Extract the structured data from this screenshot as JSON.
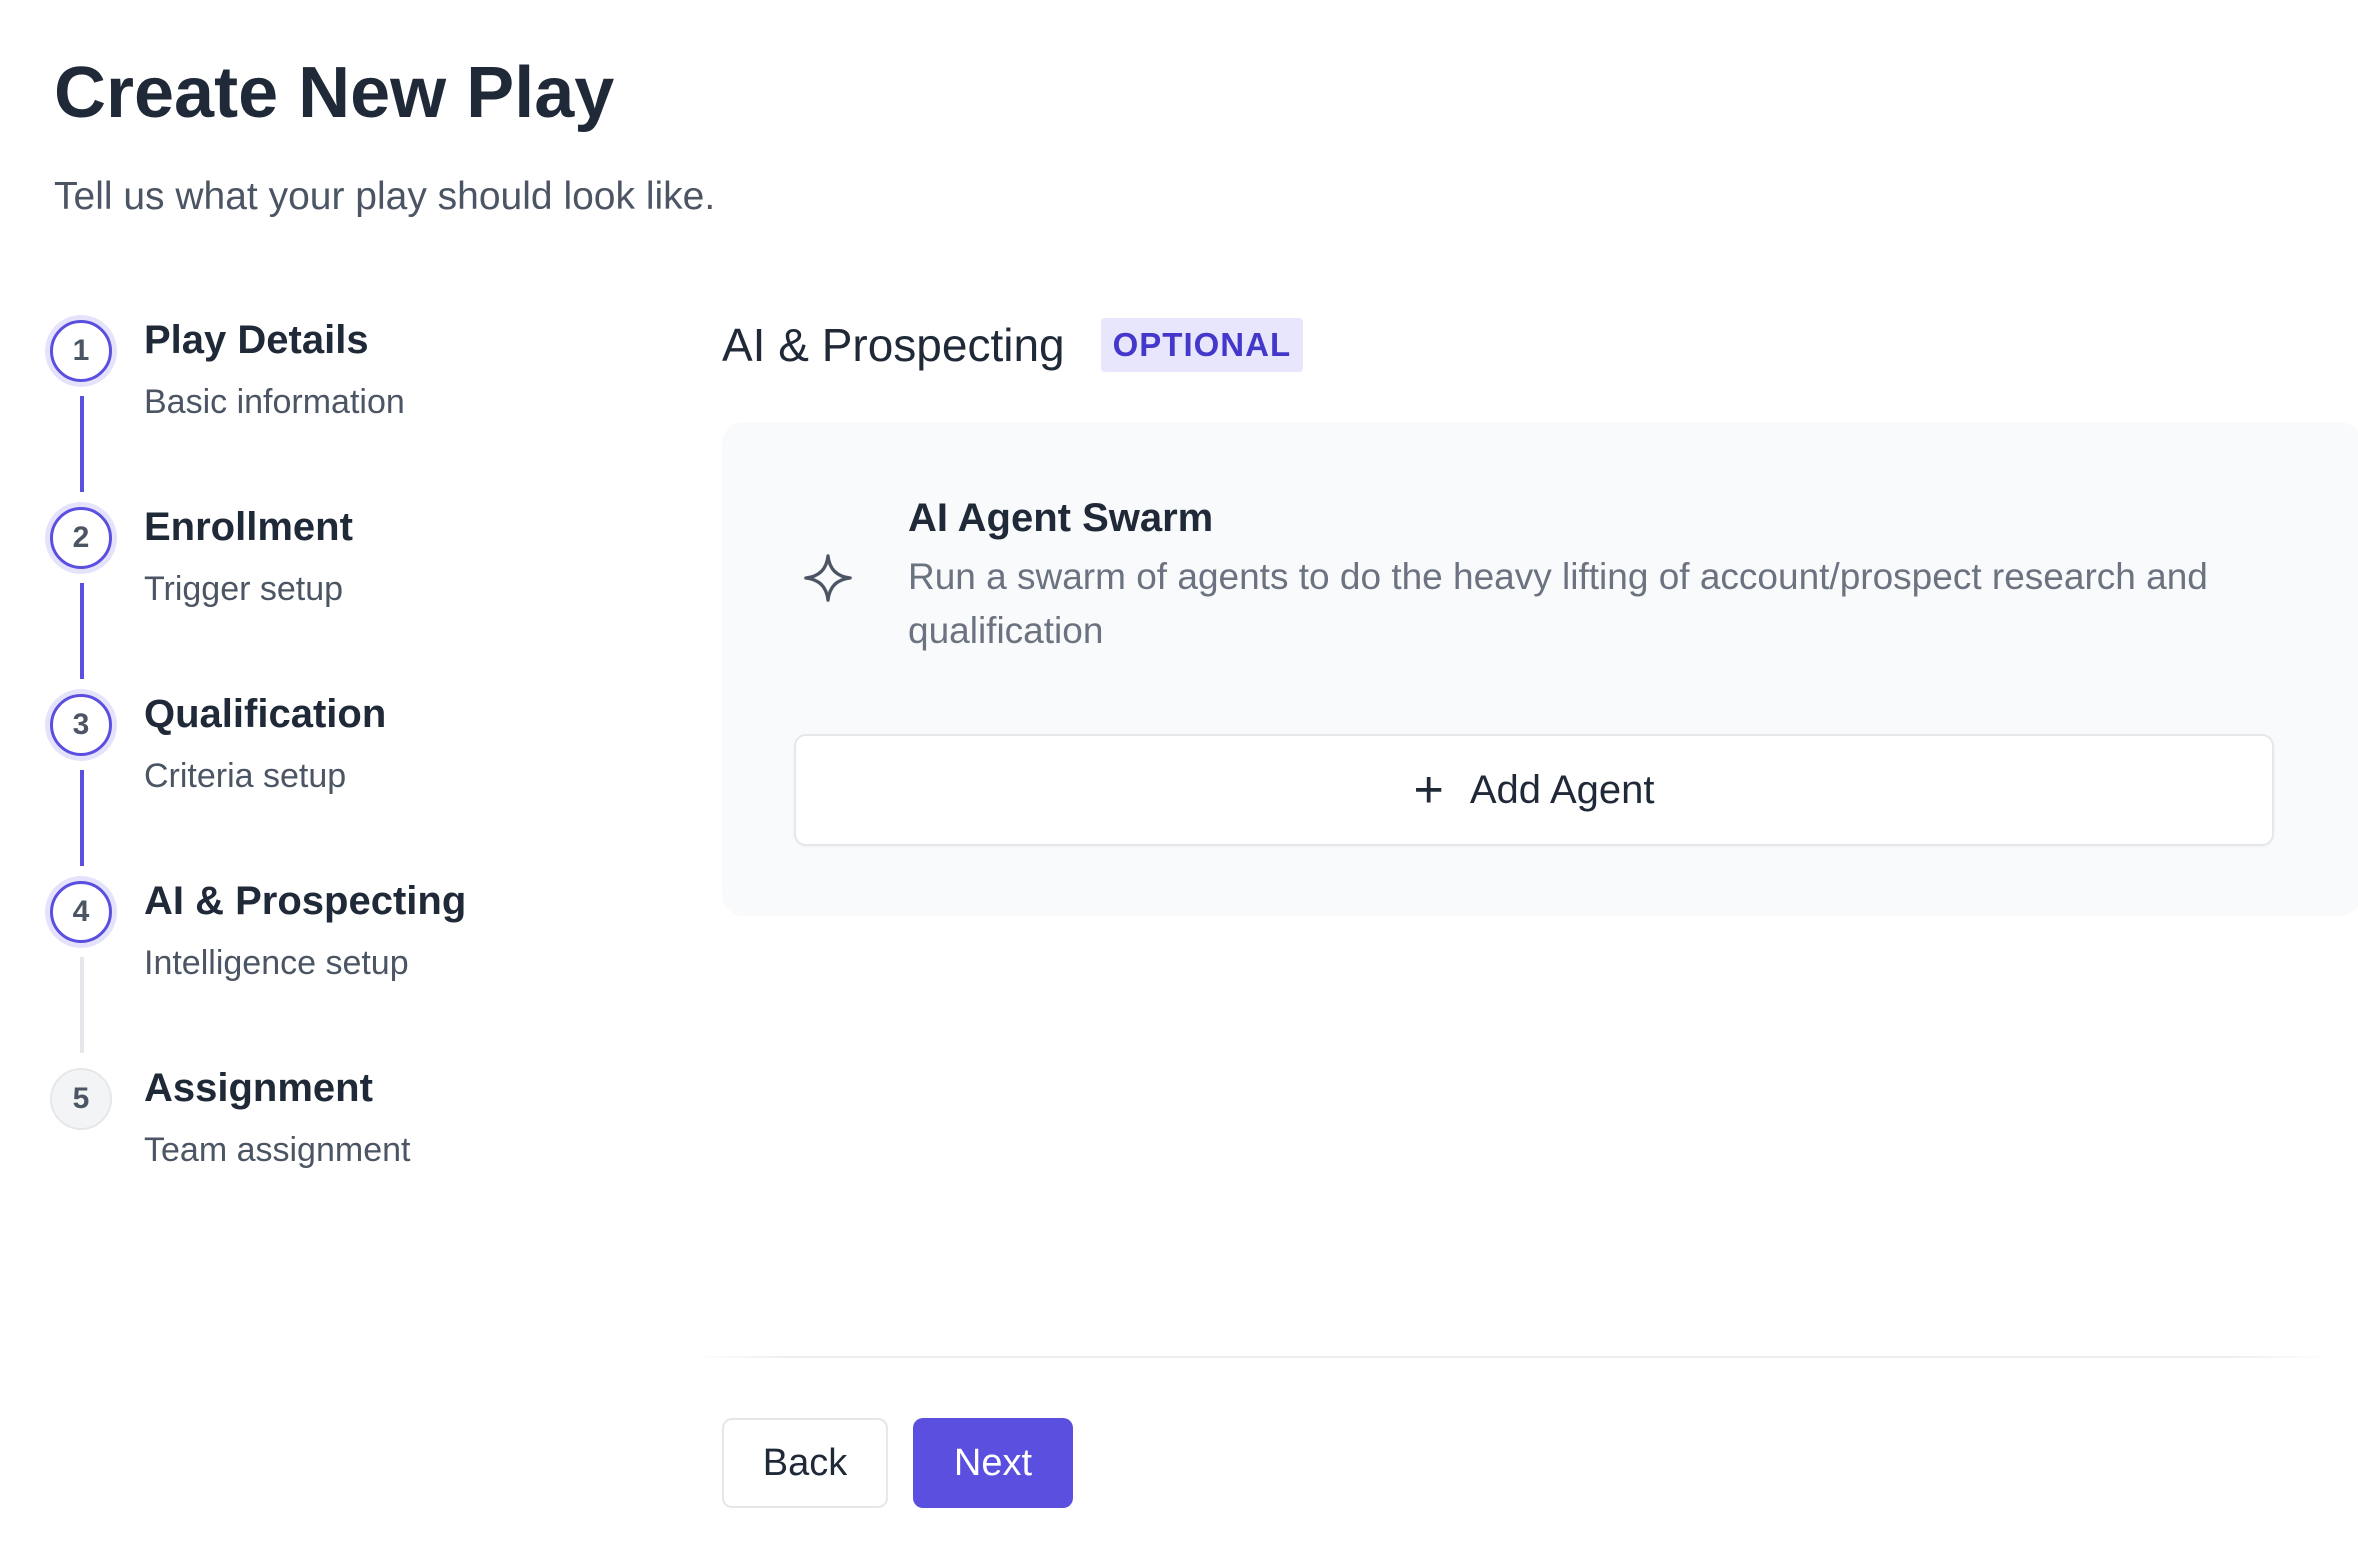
{
  "page": {
    "title": "Create New Play",
    "subtitle": "Tell us what your play should look like."
  },
  "stepper": {
    "steps": [
      {
        "number": "1",
        "title": "Play Details",
        "subtitle": "Basic information",
        "state": "completed"
      },
      {
        "number": "2",
        "title": "Enrollment",
        "subtitle": "Trigger setup",
        "state": "completed"
      },
      {
        "number": "3",
        "title": "Qualification",
        "subtitle": "Criteria setup",
        "state": "completed"
      },
      {
        "number": "4",
        "title": "AI & Prospecting",
        "subtitle": "Intelligence setup",
        "state": "active"
      },
      {
        "number": "5",
        "title": "Assignment",
        "subtitle": "Team assignment",
        "state": "upcoming"
      }
    ]
  },
  "section": {
    "title": "AI & Prospecting",
    "badge": "OPTIONAL"
  },
  "agent_card": {
    "icon": "sparkle-icon",
    "title": "AI Agent Swarm",
    "description": "Run a swarm of agents to do the heavy lifting of account/prospect research and qualification",
    "add_button": {
      "icon": "plus-icon",
      "label": "Add Agent"
    }
  },
  "footer": {
    "back_label": "Back",
    "next_label": "Next"
  },
  "colors": {
    "accent": "#5b4fe0",
    "badge_bg": "#e8e6fc",
    "badge_text": "#4338ca",
    "panel_bg": "#f9fafb",
    "inactive_connector": "#e5e7eb"
  }
}
